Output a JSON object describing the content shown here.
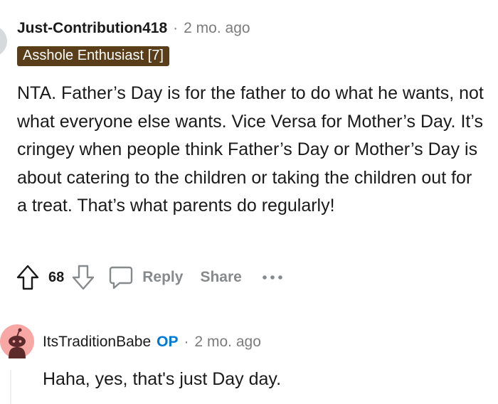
{
  "comment1": {
    "username": "Just-Contribution418",
    "separator": "·",
    "timestamp": "2 mo. ago",
    "flair": "Asshole Enthusiast [7]",
    "flair_color": "#5a3e1a",
    "body": "NTA. Father’s Day is for the father to do what he wants, not what everyone else wants. Vice Versa for Mother’s Day. It’s cringey when people think Father’s Day or Mother’s Day is about catering to the children or taking the children out for a treat. That’s what parents do regularly!",
    "vote_count": "68",
    "actions": {
      "upvote_icon": "upvote-arrow-icon",
      "downvote_icon": "downvote-arrow-icon",
      "reply_icon": "speech-bubble-icon",
      "reply_label": "Reply",
      "share_label": "Share",
      "more_icon": "ellipsis-icon",
      "more_label": "···"
    }
  },
  "comment2": {
    "username": "ItsTraditionBabe",
    "op_badge": "OP",
    "op_color": "#0079d3",
    "separator": "·",
    "timestamp": "2 mo. ago",
    "avatar_icon": "snoo-avatar-icon",
    "avatar_color": "#f7a7a4",
    "body": "Haha, yes, that's just Day day."
  }
}
